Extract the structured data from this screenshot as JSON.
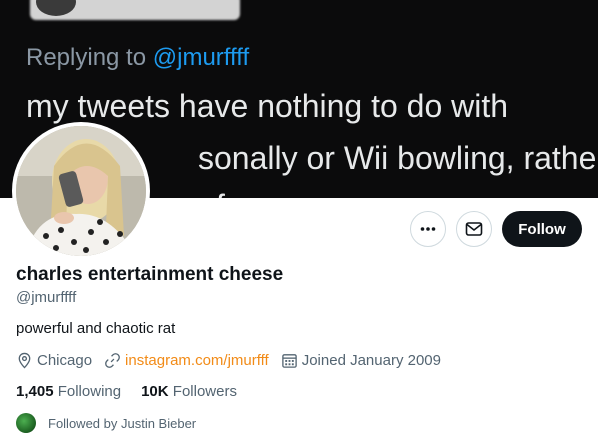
{
  "banner": {
    "reply_prefix": "Replying to",
    "reply_handle": "@jmurffff",
    "tweet_line1": "my tweets have nothing to do with",
    "tweet_line2": "sonally or Wii bowling, rather",
    "tweet_line3": "f"
  },
  "profile": {
    "name": "charles entertainment cheese",
    "handle": "@jmurffff",
    "bio": "powerful and chaotic rat",
    "location": "Chicago",
    "website": "instagram.com/jmurfff",
    "joined": "Joined January 2009",
    "following_count": "1,405",
    "following_label": "Following",
    "followers_count": "10K",
    "followers_label": "Followers",
    "followed_by": "Followed by Justin Bieber"
  },
  "actions": {
    "more_icon": "more-icon",
    "message_icon": "envelope-icon",
    "follow_label": "Follow"
  },
  "colors": {
    "link": "#f28b17",
    "follow_bg": "#0f1419",
    "muted": "#536471"
  }
}
